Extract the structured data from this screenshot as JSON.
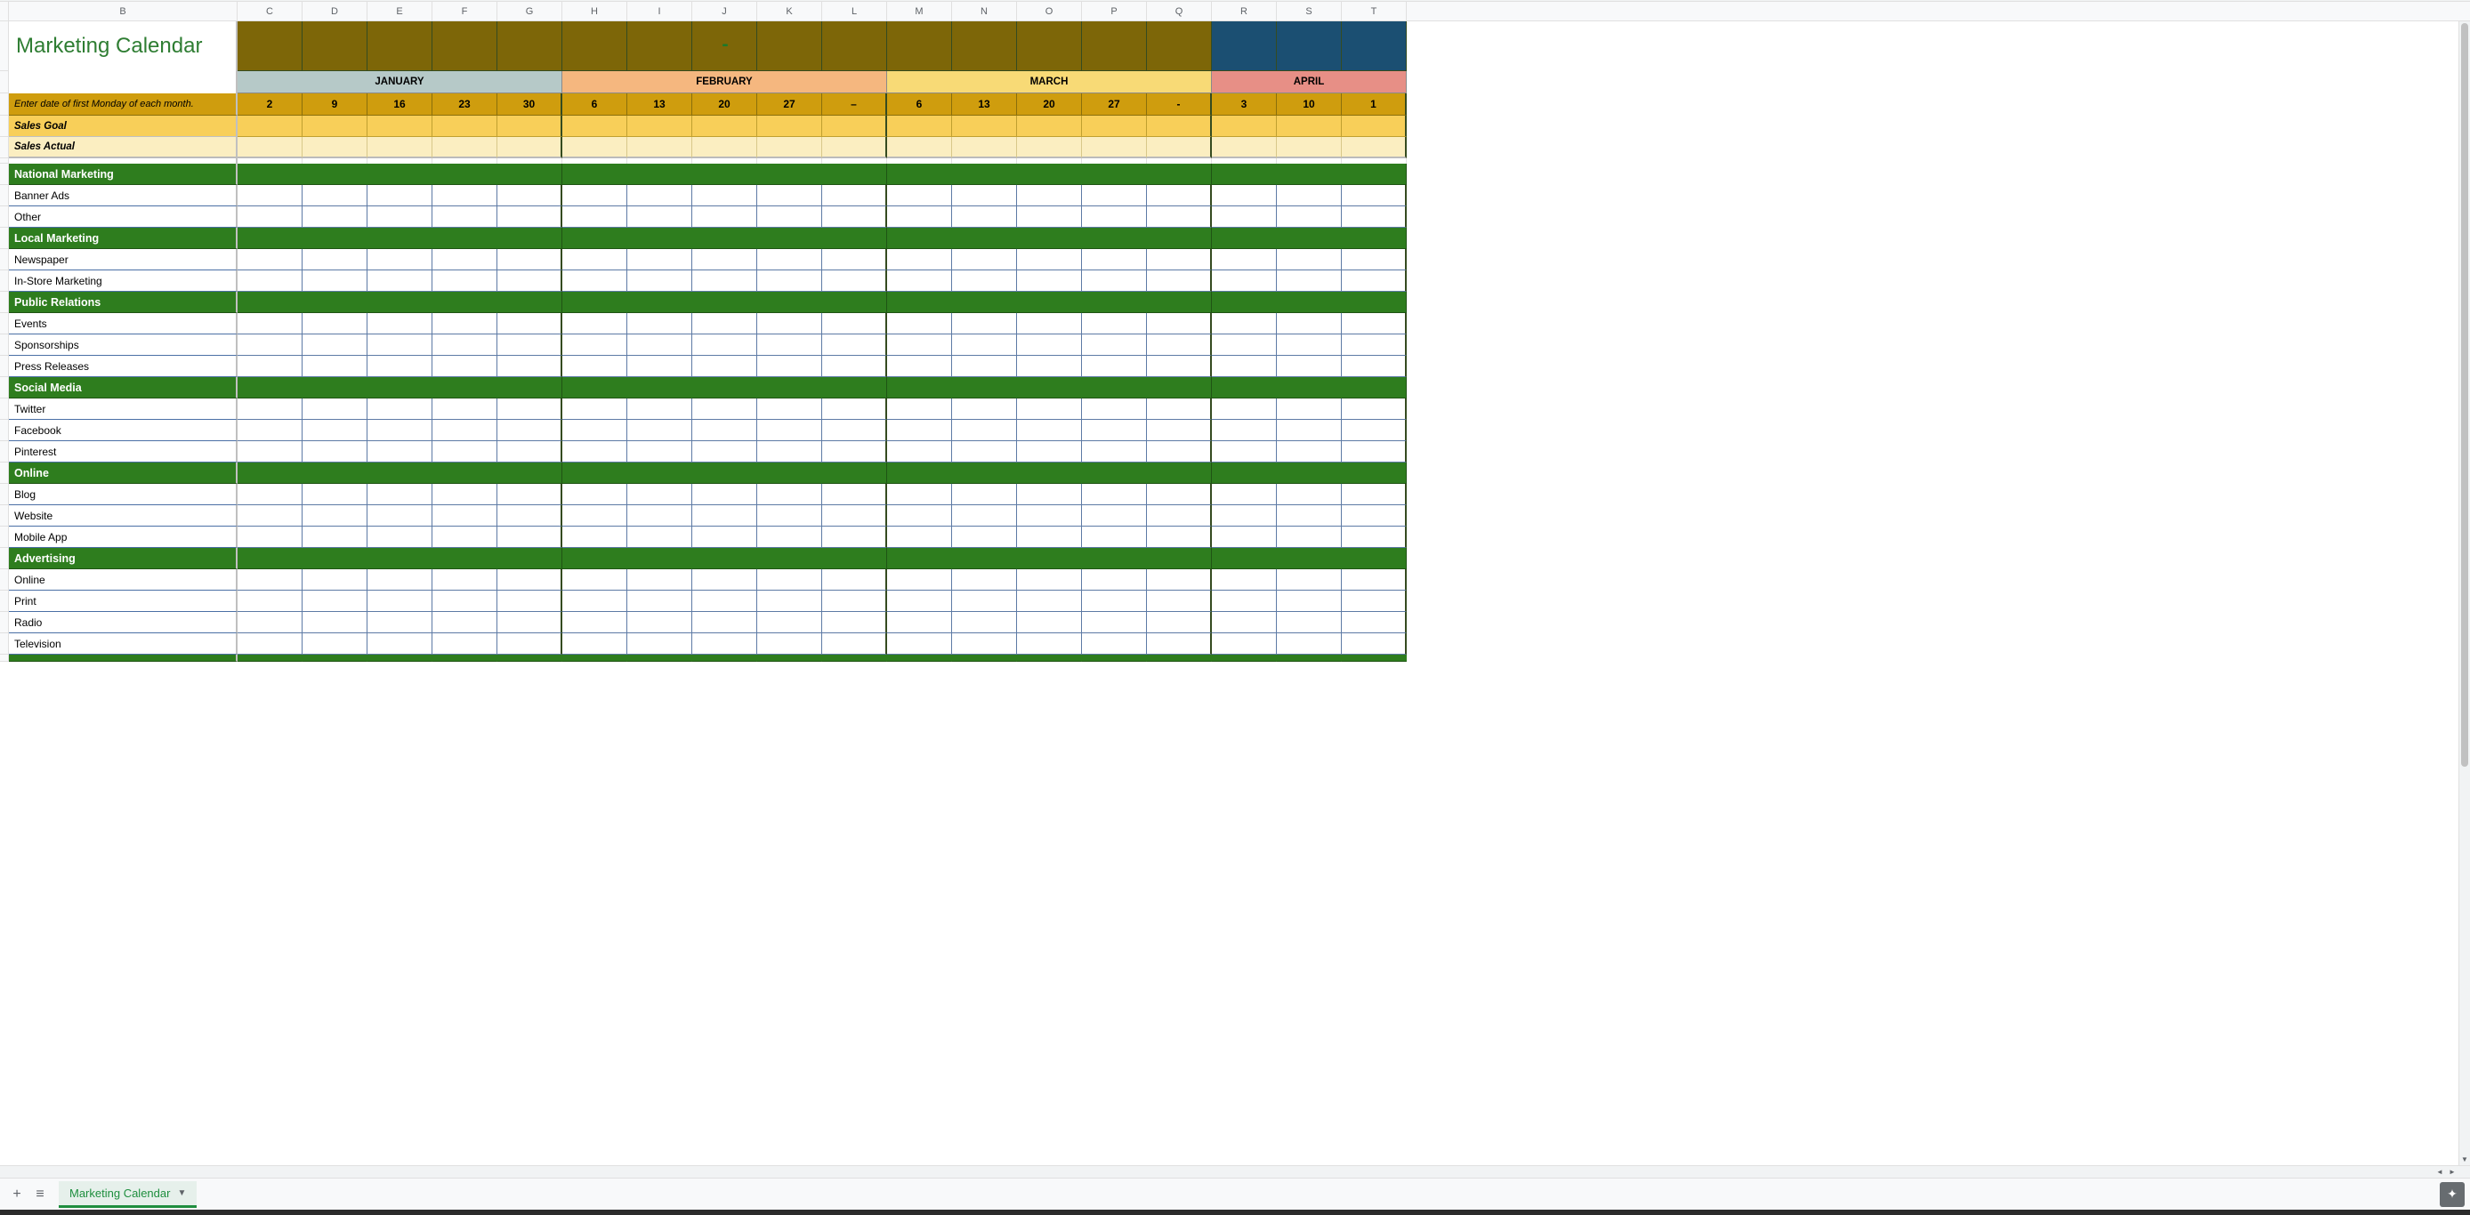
{
  "title": "Marketing Calendar",
  "column_letters": [
    "B",
    "C",
    "D",
    "E",
    "F",
    "G",
    "H",
    "I",
    "J",
    "K",
    "L",
    "M",
    "N",
    "O",
    "P",
    "Q",
    "R",
    "S",
    "T"
  ],
  "months": [
    {
      "name": "JANUARY",
      "class": "jan",
      "weeks": [
        "2",
        "9",
        "16",
        "23",
        "30"
      ]
    },
    {
      "name": "FEBRUARY",
      "class": "feb",
      "weeks": [
        "6",
        "13",
        "20",
        "27",
        "–"
      ]
    },
    {
      "name": "MARCH",
      "class": "mar",
      "weeks": [
        "6",
        "13",
        "20",
        "27",
        "-"
      ]
    },
    {
      "name": "APRIL",
      "class": "apr",
      "weeks": [
        "3",
        "10",
        "1"
      ]
    }
  ],
  "instructions_label": "Enter date of first Monday of each month.",
  "sales_goal_label": "Sales Goal",
  "sales_actual_label": "Sales Actual",
  "sections": [
    {
      "name": "National Marketing",
      "rows": [
        "Banner Ads",
        "Other"
      ]
    },
    {
      "name": "Local Marketing",
      "rows": [
        "Newspaper",
        "In-Store Marketing"
      ]
    },
    {
      "name": "Public Relations",
      "rows": [
        "Events",
        "Sponsorships",
        "Press Releases"
      ]
    },
    {
      "name": "Social Media",
      "rows": [
        "Twitter",
        "Facebook",
        "Pinterest"
      ]
    },
    {
      "name": "Online",
      "rows": [
        "Blog",
        "Website",
        "Mobile App"
      ]
    },
    {
      "name": "Advertising",
      "rows": [
        "Online",
        "Print",
        "Radio",
        "Television"
      ]
    }
  ],
  "tab_name": "Marketing Calendar",
  "tabbar": {
    "add_tooltip": "Add Sheet",
    "all_tooltip": "All Sheets"
  }
}
